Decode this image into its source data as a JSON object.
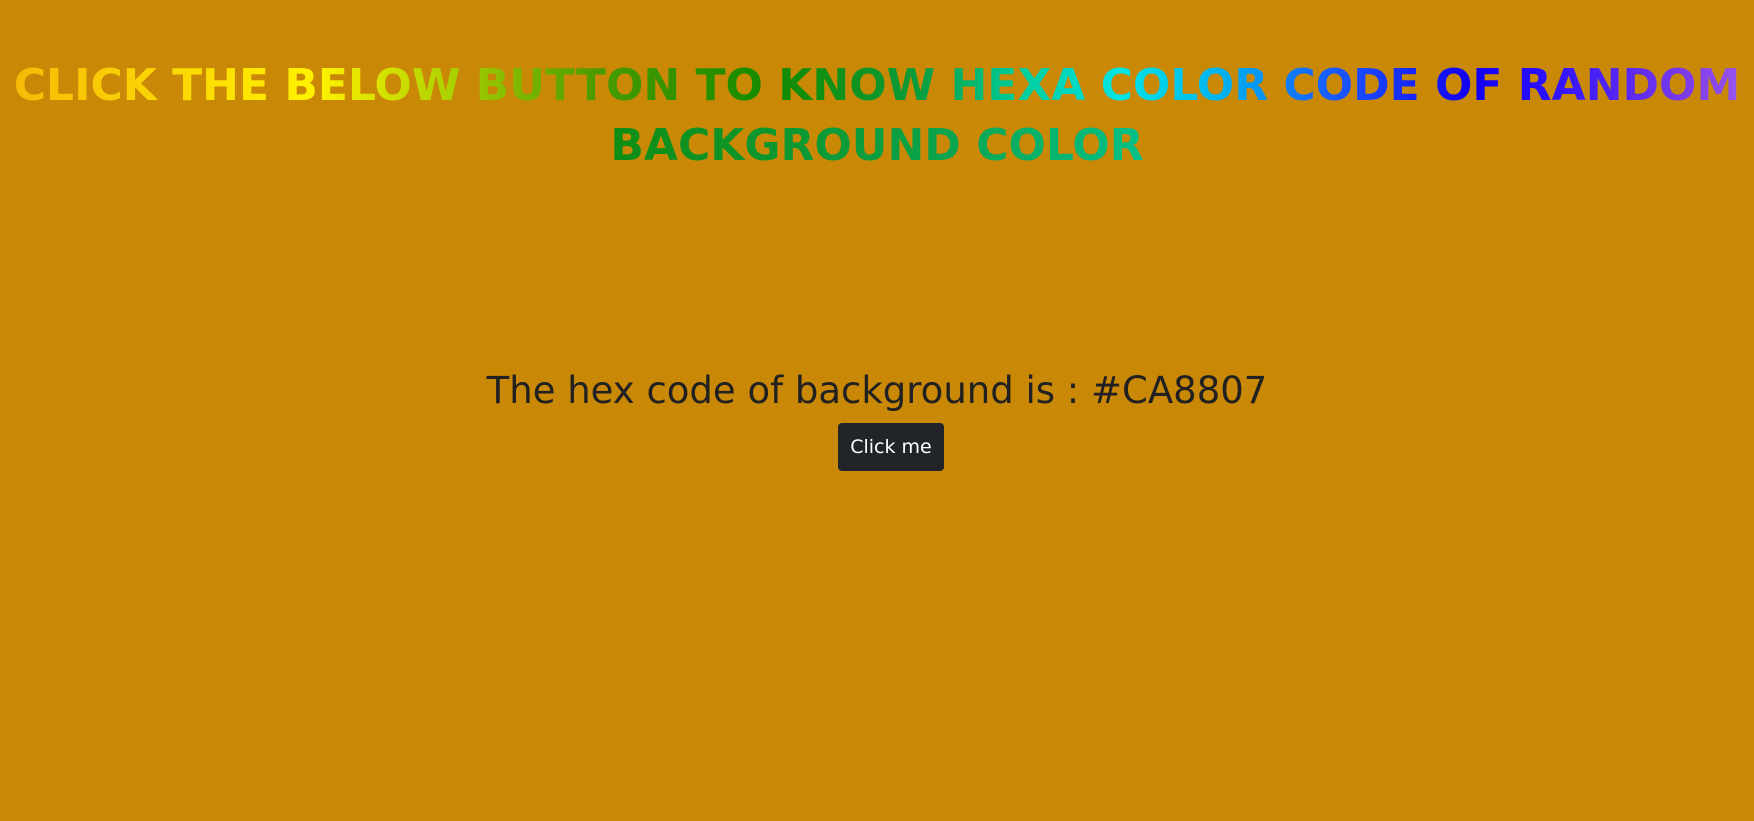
{
  "page": {
    "background_color": "#CA8807"
  },
  "heading": {
    "line1": "CLICK THE BELOW BUTTON TO KNOW HEXA COLOR CODE OF RANDOM",
    "line2": "BACKGROUND COLOR"
  },
  "hex_display": {
    "text": "The hex code of background is : #CA8807"
  },
  "button": {
    "label": "Click me",
    "bg_color": "#212529",
    "text_color": "#FFFFFF"
  }
}
